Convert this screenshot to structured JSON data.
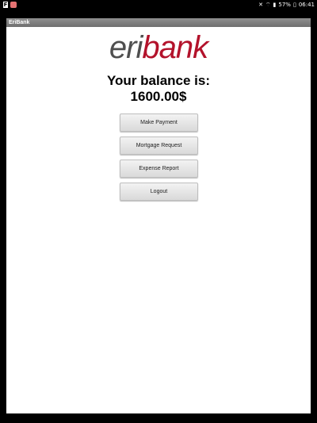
{
  "status_bar": {
    "left_icons": [
      "F",
      "app-notification-icon"
    ],
    "battery_percent": "57%",
    "time": "06:41",
    "icons": [
      "mute-icon",
      "wifi-icon",
      "signal-icon",
      "battery-icon"
    ]
  },
  "app": {
    "title": "EriBank"
  },
  "logo": {
    "eri": "eri",
    "bank": "bank"
  },
  "balance": {
    "label": "Your balance is:",
    "amount": "1600.00$"
  },
  "buttons": {
    "make_payment": "Make Payment",
    "mortgage_request": "Mortgage Request",
    "expense_report": "Expense Report",
    "logout": "Logout"
  },
  "colors": {
    "brand_red": "#b3122b",
    "brand_gray": "#4f4f4f",
    "titlebar": "#7f7f7f"
  }
}
